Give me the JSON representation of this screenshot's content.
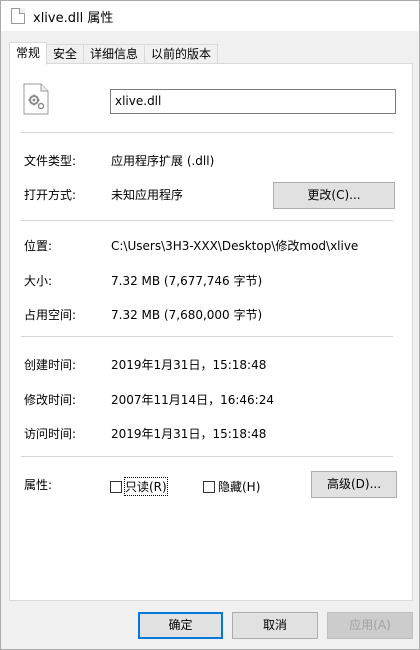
{
  "window": {
    "title": "xlive.dll 属性"
  },
  "tabs": [
    {
      "label": "常规",
      "active": true
    },
    {
      "label": "安全"
    },
    {
      "label": "详细信息"
    },
    {
      "label": "以前的版本"
    }
  ],
  "general": {
    "file_name": "xlive.dll",
    "file_icon": "dll-gear-file-icon",
    "type_label": "文件类型:",
    "type_value": "应用程序扩展 (.dll)",
    "opens_with_label": "打开方式:",
    "opens_with_value": "未知应用程序",
    "change_button": "更改(C)...",
    "location_label": "位置:",
    "location_value": "C:\\Users\\3H3-XXX\\Desktop\\修改mod\\xlive",
    "size_label": "大小:",
    "size_value": "7.32 MB (7,677,746 字节)",
    "size_on_disk_label": "占用空间:",
    "size_on_disk_value": "7.32 MB (7,680,000 字节)",
    "created_label": "创建时间:",
    "created_value": "2019年1月31日，15:18:48",
    "modified_label": "修改时间:",
    "modified_value": "2007年11月14日，16:46:24",
    "accessed_label": "访问时间:",
    "accessed_value": "2019年1月31日，15:18:48",
    "attributes_label": "属性:",
    "readonly_label": "只读(R)",
    "hidden_label": "隐藏(H)",
    "advanced_button": "高级(D)..."
  },
  "footer": {
    "ok": "确定",
    "cancel": "取消",
    "apply": "应用(A)"
  }
}
